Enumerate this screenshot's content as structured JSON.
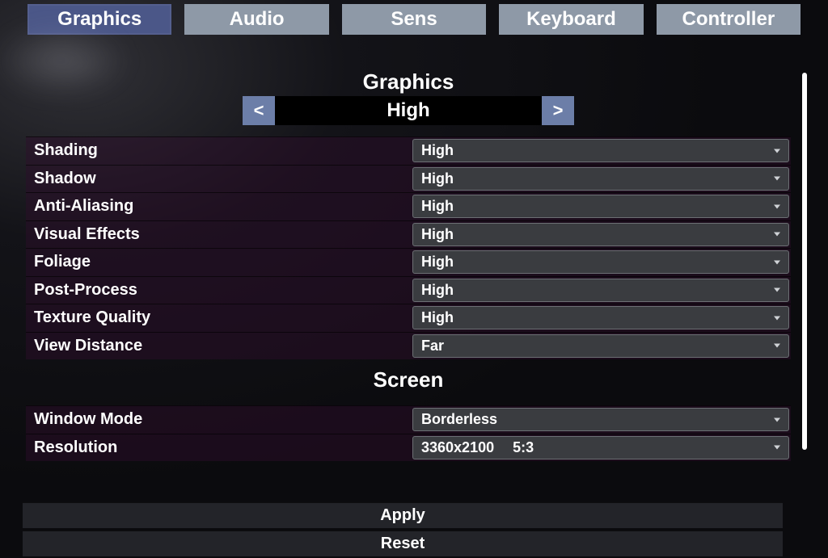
{
  "tabs": [
    {
      "label": "Graphics",
      "active": true
    },
    {
      "label": "Audio",
      "active": false
    },
    {
      "label": "Sens",
      "active": false
    },
    {
      "label": "Keyboard",
      "active": false
    },
    {
      "label": "Controller",
      "active": false
    }
  ],
  "section_graphics_title": "Graphics",
  "preset": {
    "prev_glyph": "<",
    "next_glyph": ">",
    "value": "High"
  },
  "graphics_settings": [
    {
      "label": "Shading",
      "value": "High"
    },
    {
      "label": "Shadow",
      "value": "High"
    },
    {
      "label": "Anti-Aliasing",
      "value": "High"
    },
    {
      "label": "Visual Effects",
      "value": "High"
    },
    {
      "label": "Foliage",
      "value": "High"
    },
    {
      "label": "Post-Process",
      "value": "High"
    },
    {
      "label": "Texture Quality",
      "value": "High"
    },
    {
      "label": "View Distance",
      "value": "Far"
    }
  ],
  "section_screen_title": "Screen",
  "screen_settings": [
    {
      "label": "Window Mode",
      "value": "Borderless"
    },
    {
      "label": "Resolution",
      "value": "3360x2100  5:3"
    }
  ],
  "apply_label": "Apply",
  "reset_label": "Reset"
}
